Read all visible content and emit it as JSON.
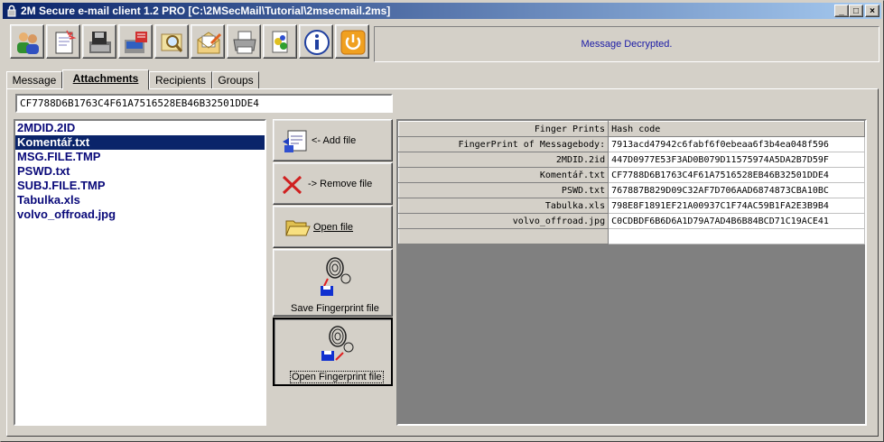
{
  "window": {
    "title": "2M Secure e-mail client 1.2 PRO [C:\\2MSecMail\\Tutorial\\2msecmail.2ms]",
    "minimize_label": "_",
    "maximize_label": "□",
    "close_label": "×"
  },
  "toolbar": {
    "icons": [
      "users-icon",
      "new-message-icon",
      "save-disk-icon",
      "send-receive-icon",
      "search-icon",
      "mail-icon",
      "print-icon",
      "settings-icon",
      "info-icon",
      "power-icon"
    ]
  },
  "status": {
    "message": "Message Decrypted."
  },
  "tabs": [
    {
      "label": "Message"
    },
    {
      "label": "Attachments"
    },
    {
      "label": "Recipients"
    },
    {
      "label": "Groups"
    }
  ],
  "hash_field": {
    "value": "CF7788D6B1763C4F61A7516528EB46B32501DDE4"
  },
  "files": [
    {
      "name": "2MDID.2ID"
    },
    {
      "name": "Komentář.txt"
    },
    {
      "name": "MSG.FILE.TMP"
    },
    {
      "name": "PSWD.txt"
    },
    {
      "name": "SUBJ.FILE.TMP"
    },
    {
      "name": "Tabulka.xls"
    },
    {
      "name": "volvo_offroad.jpg"
    }
  ],
  "actions": {
    "add_file": "<- Add file",
    "remove_file": "-> Remove file",
    "open_file": "Open file",
    "save_fingerprint": "Save Fingerprint file",
    "open_fingerprint": "Open Fingerprint file"
  },
  "fingerprints": {
    "headers": [
      "Finger Prints",
      "Hash code"
    ],
    "rows": [
      {
        "name": "FingerPrint of Messagebody:",
        "hash": "7913acd47942c6fabf6f0ebeaa6f3b4ea048f596"
      },
      {
        "name": "2MDID.2id",
        "hash": "447D0977E53F3AD0B079D11575974A5DA2B7D59F"
      },
      {
        "name": "Komentář.txt",
        "hash": "CF7788D6B1763C4F61A7516528EB46B32501DDE4"
      },
      {
        "name": "PSWD.txt",
        "hash": "767887B829D09C32AF7D706AAD6874873CBA10BC"
      },
      {
        "name": "Tabulka.xls",
        "hash": "798E8F1891EF21A00937C1F74AC59B1FA2E3B9B4"
      },
      {
        "name": "volvo_offroad.jpg",
        "hash": "C0CDBDF6B6D6A1D79A7AD4B6B84BCD71C19ACE41"
      }
    ]
  }
}
